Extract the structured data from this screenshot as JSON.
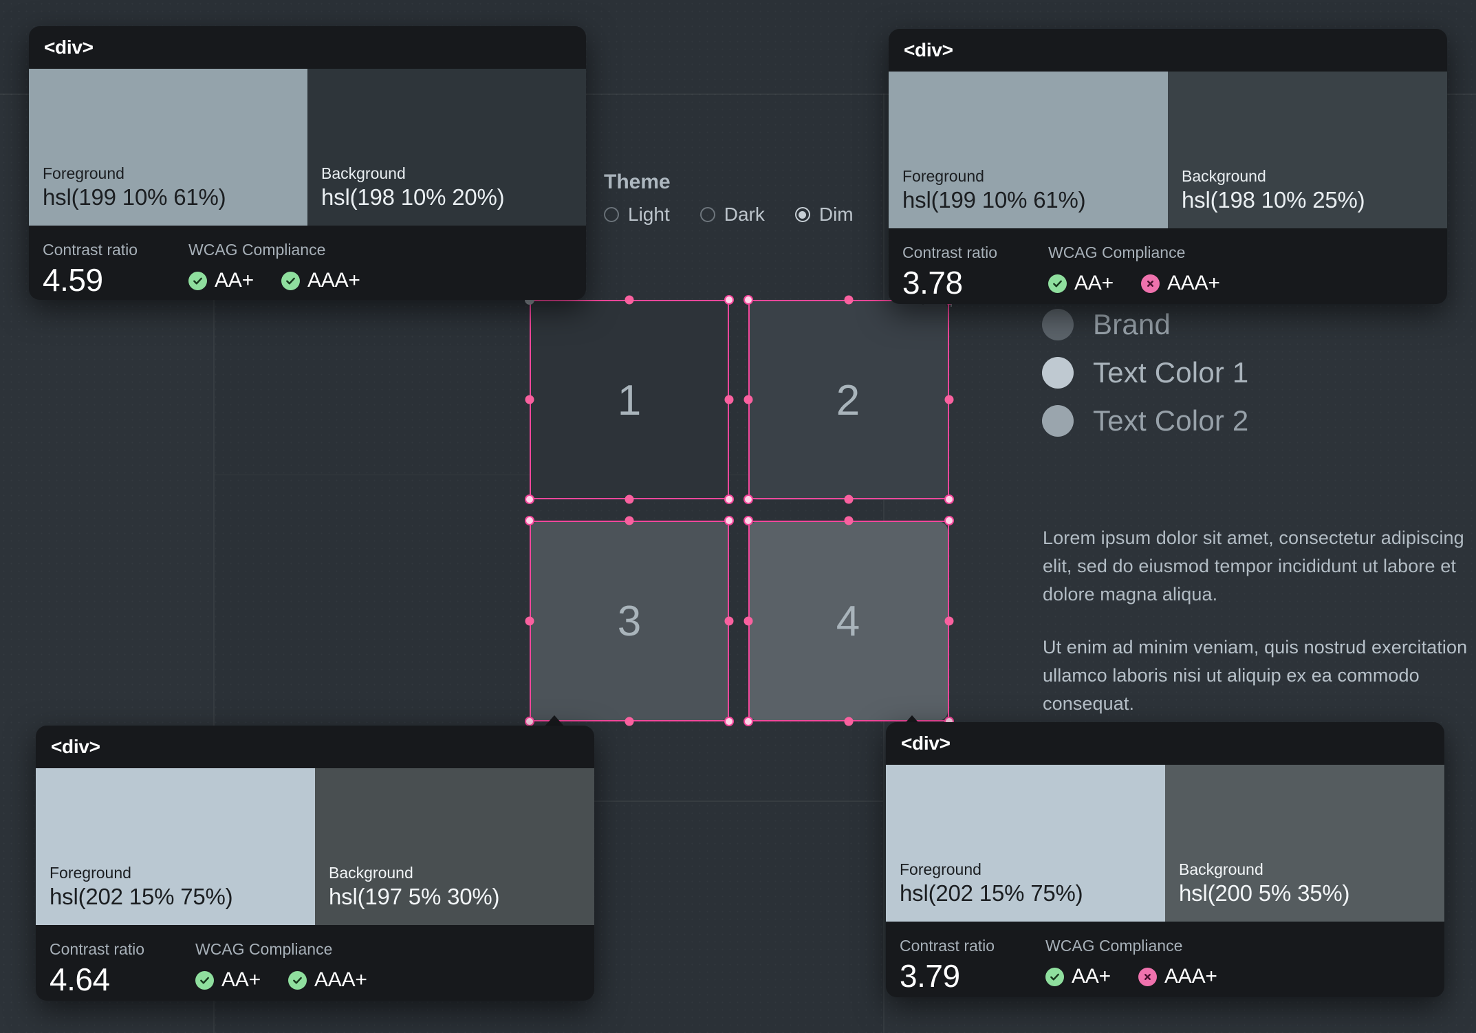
{
  "theme_panel": {
    "title": "Theme",
    "title_visible_fragment": "ne",
    "options": [
      {
        "label": "Light",
        "selected": false
      },
      {
        "label": "Dark",
        "selected": false
      },
      {
        "label": "Dim",
        "selected": true
      }
    ]
  },
  "palette": {
    "items": [
      {
        "label": "Brand",
        "color": "#5c646b"
      },
      {
        "label": "Text Color 1",
        "color": "#bfc9d1"
      },
      {
        "label": "Text Color 2",
        "color": "#9aa5ad"
      }
    ]
  },
  "body_copy": {
    "paragraph_1": "Lorem ipsum dolor sit amet, consectetur adipiscing elit, sed do eiusmod tempor incididunt ut labore et dolore magna aliqua.",
    "paragraph_2": "Ut enim ad minim veniam, quis nostrud exercitation ullamco laboris nisi ut aliquip ex ea commodo consequat.",
    "color": "#b2bcc4"
  },
  "selection_grid": {
    "cells": [
      {
        "label": "1",
        "background": "#2d3339"
      },
      {
        "label": "2",
        "background": "#3a4148"
      },
      {
        "label": "3",
        "background": "#4c5359"
      },
      {
        "label": "4",
        "background": "#5a6167"
      }
    ],
    "selection_color": "#f4479b"
  },
  "cards": [
    {
      "id": "card-top-left",
      "tag": "<div>",
      "foreground": {
        "role": "Foreground",
        "value": "hsl(199 10% 61%)",
        "color": "#94a3ab",
        "text_color": "#1b1e21"
      },
      "background": {
        "role": "Background",
        "value": "hsl(198 10% 20%)",
        "color": "#2e353a",
        "text_color": "#e9eef1"
      },
      "contrast": {
        "label": "Contrast ratio",
        "value": "4.59"
      },
      "compliance": {
        "label": "WCAG Compliance",
        "badges": [
          {
            "text": "AA+",
            "pass": true
          },
          {
            "text": "AAA+",
            "pass": true
          }
        ]
      }
    },
    {
      "id": "card-top-right",
      "tag": "<div>",
      "foreground": {
        "role": "Foreground",
        "value": "hsl(199 10% 61%)",
        "color": "#94a3ab",
        "text_color": "#1b1e21"
      },
      "background": {
        "role": "Background",
        "value": "hsl(198 10% 25%)",
        "color": "#3a4247",
        "text_color": "#e9eef1"
      },
      "contrast": {
        "label": "Contrast ratio",
        "value": "3.78"
      },
      "compliance": {
        "label": "WCAG Compliance",
        "badges": [
          {
            "text": "AA+",
            "pass": true
          },
          {
            "text": "AAA+",
            "pass": false
          }
        ]
      }
    },
    {
      "id": "card-bottom-left",
      "tag": "<div>",
      "foreground": {
        "role": "Foreground",
        "value": "hsl(202 15% 75%)",
        "color": "#bac8d2",
        "text_color": "#1b1e21"
      },
      "background": {
        "role": "Background",
        "value": "hsl(197 5% 30%)",
        "color": "#494f51",
        "text_color": "#f2f5f7"
      },
      "contrast": {
        "label": "Contrast ratio",
        "value": "4.64"
      },
      "compliance": {
        "label": "WCAG Compliance",
        "badges": [
          {
            "text": "AA+",
            "pass": true
          },
          {
            "text": "AAA+",
            "pass": true
          }
        ]
      }
    },
    {
      "id": "card-bottom-right",
      "tag": "<div>",
      "foreground": {
        "role": "Foreground",
        "value": "hsl(202 15% 75%)",
        "color": "#bac8d2",
        "text_color": "#1b1e21"
      },
      "background": {
        "role": "Background",
        "value": "hsl(200 5% 35%)",
        "color": "#555c5f",
        "text_color": "#f2f5f7"
      },
      "contrast": {
        "label": "Contrast ratio",
        "value": "3.79"
      },
      "compliance": {
        "label": "WCAG Compliance",
        "badges": [
          {
            "text": "AA+",
            "pass": true
          },
          {
            "text": "AAA+",
            "pass": false
          }
        ]
      }
    }
  ],
  "colors": {
    "page_bg": "#2b3137",
    "card_bg": "#17191c",
    "accent_pink": "#f4479b",
    "pass_green": "#8fdf9e",
    "fail_pink": "#ef72ad"
  }
}
